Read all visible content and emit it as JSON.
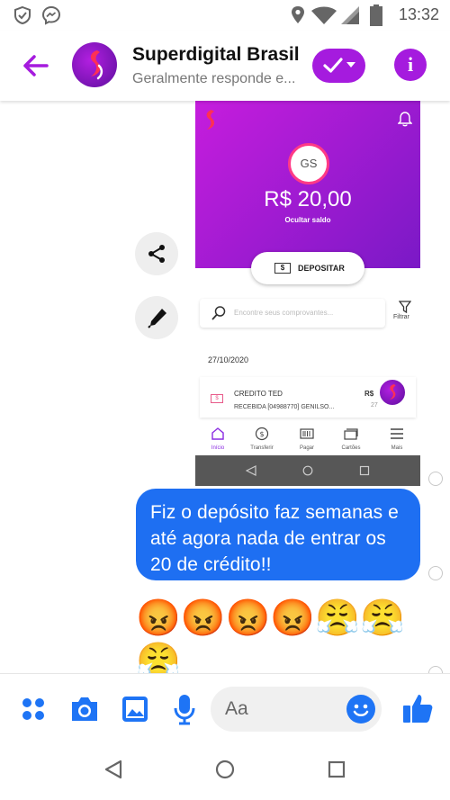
{
  "status_bar": {
    "time": "13:32",
    "icons": [
      "shield-check-icon",
      "messenger-icon",
      "location-icon",
      "wifi-icon",
      "cell-signal-icon",
      "battery-icon"
    ]
  },
  "header": {
    "title": "Superdigital Brasil",
    "subtitle": "Geralmente responde e...",
    "accent_color": "#a51bde"
  },
  "shared_screenshot": {
    "avatar_initials": "GS",
    "balance": "R$ 20,00",
    "hide_balance": "Ocultar saldo",
    "deposit_button": "DEPOSITAR",
    "search_placeholder": "Encontre seus comprovantes...",
    "filter_label": "Filtrar",
    "date": "27/10/2020",
    "transaction": {
      "title": "CREDITO TED",
      "description": "RECEBIDA [04988770] GENILSO...",
      "amount": "R$",
      "amount_sub": "27"
    },
    "nav": [
      {
        "label": "Início",
        "icon": "home-icon"
      },
      {
        "label": "Transferir",
        "icon": "transfer-icon"
      },
      {
        "label": "Pagar",
        "icon": "barcode-icon"
      },
      {
        "label": "Cartões",
        "icon": "cards-icon"
      },
      {
        "label": "Mais",
        "icon": "menu-icon"
      }
    ]
  },
  "messages": {
    "outgoing_text": "Fiz o depósito faz semanas e até agora nada de entrar os 20 de crédito!!",
    "emojis_row1": "😡😡😡😡😤😤",
    "emojis_row2": "😤"
  },
  "composer": {
    "placeholder": "Aa",
    "accent_color": "#1e74f5"
  }
}
